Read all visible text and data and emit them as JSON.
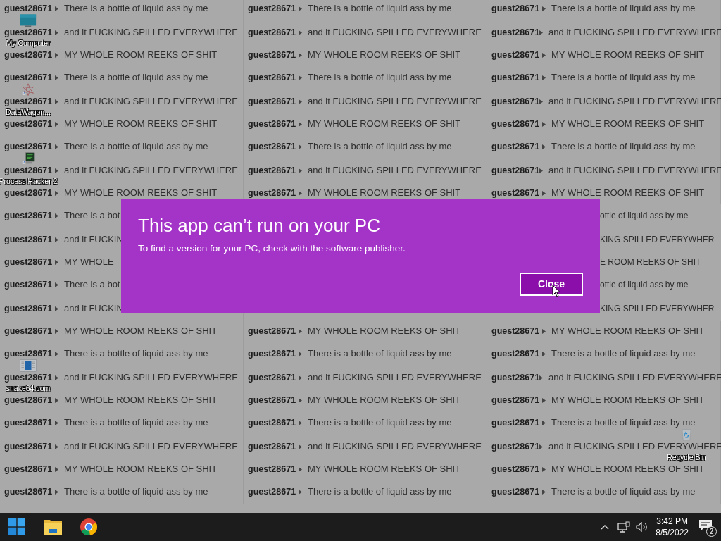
{
  "desktop_icons": [
    {
      "label": "My Computer",
      "kind": "monitor"
    },
    {
      "label": "DataWagon...",
      "kind": "web"
    },
    {
      "label": "Process Hacker 2",
      "kind": "terminal"
    },
    {
      "label": "snake64.com",
      "kind": "document"
    },
    {
      "label": "Recycle Bin",
      "kind": "recycle"
    }
  ],
  "wallpaper_rows": [
    {
      "cells": [
        {
          "kind": "full",
          "user": "guest28671",
          "text": "There is a bottle of liquid ass by me"
        },
        {
          "kind": "full",
          "user": "guest28671",
          "text": "There is a bottle of liquid ass by me"
        },
        {
          "kind": "full",
          "user": "guest28671",
          "text": "There is a bottle of liquid ass by me"
        }
      ]
    },
    {
      "cells": [
        {
          "kind": "full",
          "user": "guest28671",
          "text": "and it FUCKING SPILLED EVERYWHERE"
        },
        {
          "kind": "full",
          "user": "guest28671",
          "text": "and it FUCKING SPILLED EVERYWHERE"
        },
        {
          "kind": "full",
          "user": "guest28671",
          "text": "and it FUCKING SPILLED EVERYWHERE"
        }
      ]
    },
    {
      "cells": [
        {
          "kind": "full",
          "user": "guest28671",
          "text": "MY WHOLE ROOM REEKS OF SHIT"
        },
        {
          "kind": "full",
          "user": "guest28671",
          "text": "MY WHOLE ROOM REEKS OF SHIT"
        },
        {
          "kind": "full",
          "user": "guest28671",
          "text": "MY WHOLE ROOM REEKS OF SHIT"
        }
      ]
    },
    {
      "cells": [
        {
          "kind": "full",
          "user": "guest28671",
          "text": "There is a bottle of liquid ass by me"
        },
        {
          "kind": "full",
          "user": "guest28671",
          "text": "There is a bottle of liquid ass by me"
        },
        {
          "kind": "full",
          "user": "guest28671",
          "text": "There is a bottle of liquid ass by me"
        }
      ]
    },
    {
      "cells": [
        {
          "kind": "full",
          "user": "guest28671",
          "text": "and it FUCKING SPILLED EVERYWHERE"
        },
        {
          "kind": "full",
          "user": "guest28671",
          "text": "and it FUCKING SPILLED EVERYWHERE"
        },
        {
          "kind": "full",
          "user": "guest28671",
          "text": "and it FUCKING SPILLED EVERYWHERE"
        }
      ]
    },
    {
      "cells": [
        {
          "kind": "full",
          "user": "guest28671",
          "text": "MY WHOLE ROOM REEKS OF SHIT"
        },
        {
          "kind": "full",
          "user": "guest28671",
          "text": "MY WHOLE ROOM REEKS OF SHIT"
        },
        {
          "kind": "full",
          "user": "guest28671",
          "text": "MY WHOLE ROOM REEKS OF SHIT"
        }
      ]
    },
    {
      "cells": [
        {
          "kind": "full",
          "user": "guest28671",
          "text": "There is a bottle of liquid ass by me"
        },
        {
          "kind": "full",
          "user": "guest28671",
          "text": "There is a bottle of liquid ass by me"
        },
        {
          "kind": "full",
          "user": "guest28671",
          "text": "There is a bottle of liquid ass by me"
        }
      ]
    },
    {
      "cells": [
        {
          "kind": "full",
          "user": "guest28671",
          "text": "and it FUCKING SPILLED EVERYWHERE"
        },
        {
          "kind": "full",
          "user": "guest28671",
          "text": "and it FUCKING SPILLED EVERYWHERE"
        },
        {
          "kind": "full",
          "user": "guest28671",
          "text": "and it FUCKING SPILLED EVERYWHERE"
        }
      ]
    },
    {
      "cells": [
        {
          "kind": "full",
          "user": "guest28671",
          "text": "MY WHOLE ROOM REEKS OF SHIT"
        },
        {
          "kind": "full",
          "user": "guest28671",
          "text": "MY WHOLE ROOM REEKS OF SHIT"
        },
        {
          "kind": "full",
          "user": "guest28671",
          "text": "MY WHOLE ROOM REEKS OF SHIT"
        }
      ]
    },
    {
      "cells": [
        {
          "kind": "full",
          "user": "guest28671",
          "text": "There is a bot"
        },
        {
          "kind": "tail",
          "text": "ottle of liquid ass by me"
        }
      ]
    },
    {
      "cells": [
        {
          "kind": "full",
          "user": "guest28671",
          "text": "and it FUCKIN"
        },
        {
          "kind": "tail",
          "text": "KING SPILLED EVERYWHER"
        }
      ]
    },
    {
      "cells": [
        {
          "kind": "full",
          "user": "guest28671",
          "text": "MY WHOLE"
        },
        {
          "kind": "tail",
          "text": "E ROOM REEKS OF SHIT"
        }
      ]
    },
    {
      "cells": [
        {
          "kind": "full",
          "user": "guest28671",
          "text": "There is a bot"
        },
        {
          "kind": "tail",
          "text": "ottle of liquid ass by me"
        }
      ]
    },
    {
      "cells": [
        {
          "kind": "full",
          "user": "guest28671",
          "text": "and it FUCKIN"
        },
        {
          "kind": "tail",
          "text": "KING SPILLED EVERYWHER"
        }
      ]
    },
    {
      "cells": [
        {
          "kind": "full",
          "user": "guest28671",
          "text": "MY WHOLE ROOM REEKS OF SHIT"
        },
        {
          "kind": "full",
          "user": "guest28671",
          "text": "MY WHOLE ROOM REEKS OF SHIT"
        },
        {
          "kind": "full",
          "user": "guest28671",
          "text": "MY WHOLE ROOM REEKS OF SHIT"
        }
      ]
    },
    {
      "cells": [
        {
          "kind": "full",
          "user": "guest28671",
          "text": "There is a bottle of liquid ass by me"
        },
        {
          "kind": "full",
          "user": "guest28671",
          "text": "There is a bottle of liquid ass by me"
        },
        {
          "kind": "full",
          "user": "guest28671",
          "text": "There is a bottle of liquid ass by me"
        }
      ]
    },
    {
      "cells": [
        {
          "kind": "full",
          "user": "guest28671",
          "text": "and it FUCKING SPILLED EVERYWHERE"
        },
        {
          "kind": "full",
          "user": "guest28671",
          "text": "and it FUCKING SPILLED EVERYWHERE"
        },
        {
          "kind": "full",
          "user": "guest28671",
          "text": "and it FUCKING SPILLED EVERYWHERE"
        }
      ]
    },
    {
      "cells": [
        {
          "kind": "full",
          "user": "guest28671",
          "text": "MY WHOLE ROOM REEKS OF SHIT"
        },
        {
          "kind": "full",
          "user": "guest28671",
          "text": "MY WHOLE ROOM REEKS OF SHIT"
        },
        {
          "kind": "full",
          "user": "guest28671",
          "text": "MY WHOLE ROOM REEKS OF SHIT"
        }
      ]
    },
    {
      "cells": [
        {
          "kind": "full",
          "user": "guest28671",
          "text": "There is a bottle of liquid ass by me"
        },
        {
          "kind": "full",
          "user": "guest28671",
          "text": "There is a bottle of liquid ass by me"
        },
        {
          "kind": "full",
          "user": "guest28671",
          "text": "There is a bottle of liquid ass by me"
        }
      ]
    },
    {
      "cells": [
        {
          "kind": "full",
          "user": "guest28671",
          "text": "and it FUCKING SPILLED EVERYWHERE"
        },
        {
          "kind": "full",
          "user": "guest28671",
          "text": "and it FUCKING SPILLED EVERYWHERE"
        },
        {
          "kind": "full",
          "user": "guest28671",
          "text": "and it FUCKING SPILLED EVERYWHERE"
        }
      ]
    },
    {
      "cells": [
        {
          "kind": "full",
          "user": "guest28671",
          "text": "MY WHOLE ROOM REEKS OF SHIT"
        },
        {
          "kind": "full",
          "user": "guest28671",
          "text": "MY WHOLE ROOM REEKS OF SHIT"
        },
        {
          "kind": "full",
          "user": "guest28671",
          "text": "MY WHOLE ROOM REEKS OF SHIT"
        }
      ]
    },
    {
      "cells": [
        {
          "kind": "full",
          "user": "guest28671",
          "text": "There is a bottle of liquid ass by me"
        },
        {
          "kind": "full",
          "user": "guest28671",
          "text": "There is a bottle of liquid ass by me"
        },
        {
          "kind": "full",
          "user": "guest28671",
          "text": "There is a bottle of liquid ass by me"
        }
      ]
    }
  ],
  "dialog": {
    "title": "This app can’t run on your PC",
    "message": "To find a version for your PC, check with the software publisher.",
    "button": "Close"
  },
  "taskbar": {
    "apps": [
      {
        "kind": "start"
      },
      {
        "kind": "folder"
      },
      {
        "kind": "browser"
      }
    ],
    "time": "3:42 PM",
    "date": "8/5/2022",
    "notifications": "2"
  }
}
